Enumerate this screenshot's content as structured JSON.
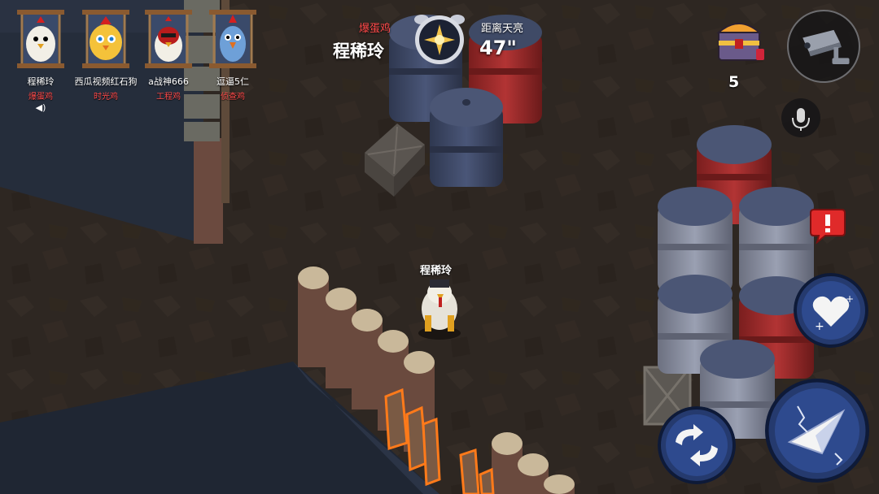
{
  "players": [
    {
      "name": "程稀玲",
      "role": "爆蛋鸡",
      "speaking": true,
      "icon": "caged-white-chicken"
    },
    {
      "name": "西瓜视频红石狗",
      "role": "时光鸡",
      "speaking": false,
      "icon": "caged-yellow-chicken"
    },
    {
      "name": "a战神666",
      "role": "工程鸡",
      "speaking": false,
      "icon": "caged-red-masked-chicken"
    },
    {
      "name": "逗逼5仁",
      "role": "侦查鸡",
      "speaking": false,
      "icon": "caged-blue-chicken"
    }
  ],
  "speaker_glyph": "◀)",
  "top_center": {
    "role_label": "爆蛋鸡",
    "self_name": "程稀玲",
    "dawn_label": "距离天亮",
    "dawn_timer": "47\""
  },
  "chest_count": "5",
  "player_label": "程稀玲",
  "colors": {
    "role_red": "#ff4a4a",
    "barrel_blue": "#3f4a66",
    "barrel_red": "#9a2a2a",
    "skill_ring": "#1f3d8f",
    "ground": "#2e2722"
  },
  "icons": {
    "chest": "treasure-chest-icon",
    "camera": "security-camera-icon",
    "mic": "microphone-icon",
    "alert": "exclamation-alert-icon",
    "heal": "heal-heart-icon",
    "flip": "flip-arrows-icon",
    "attack": "paper-plane-attack-icon"
  }
}
